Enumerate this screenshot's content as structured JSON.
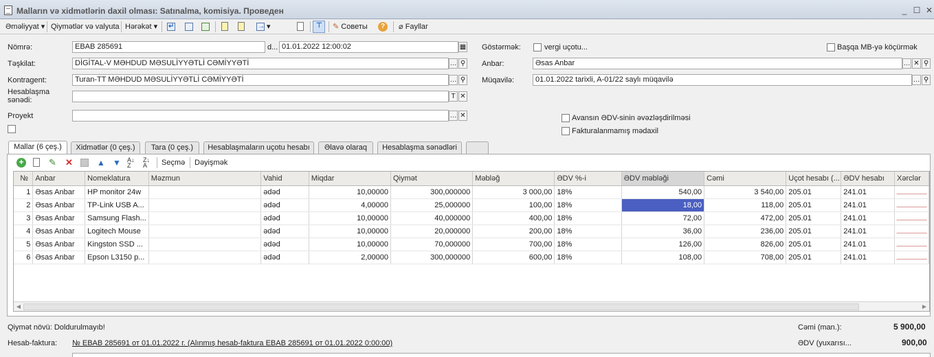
{
  "window": {
    "title": "Malların və xidmətlərin daxil olması: Satınalma, komisiya. Проведен"
  },
  "toolbar": {
    "emeliyyat": "Əməliyyat",
    "qiymetler": "Qiymətlər və valyuta",
    "hereket": "Hərəkət",
    "sovety": "Советы",
    "fayllar": "Fayllar"
  },
  "form": {
    "nomre_label": "Nömrə:",
    "nomre_value": "EBAB 285691",
    "date_prefix": "d...",
    "date_value": "01.01.2022 12:00:02",
    "teshkilat_label": "Təşkilat:",
    "teshkilat_value": "DİGİTAL-V  MƏHDUD MƏSULİYYƏTLİ CƏMİYYƏTİ",
    "kontragent_label": "Kontragent:",
    "kontragent_value": "Turan-TT MƏHDUD MƏSULİYYƏTLİ CƏMİYYƏTİ",
    "hesablashma_label_1": "Hesablaşma",
    "hesablashma_label_2": "sənədi:",
    "hesablashma_value": "",
    "proyekt_label": "Proyekt",
    "proyekt_value": "",
    "gostermek_label": "Göstərmək:",
    "vergi_label": "vergi uçotu...",
    "basqa_label": "Başqa MB-yə köçürmək",
    "anbar_label": "Anbar:",
    "anbar_value": "Əsas Anbar",
    "muqavile_label": "Müqavilə:",
    "muqavile_value": "01.01.2022 tarixli, A-01/22 saylı müqavilə",
    "avans_label": "Avansın ƏDV-sinin əvəzləşdirilməsi",
    "faktura_label": "Fakturalanmamış mədaxil"
  },
  "tabs": [
    "Mallar (6 çeş.)",
    "Xidmətlər (0 çeş.)",
    "Tara (0 çeş.)",
    "Hesablaşmaların uçotu hesabı",
    "Əlavə olaraq",
    "Hesablaşma sənədləri",
    ""
  ],
  "gridbar": {
    "secme": "Seçmə",
    "deyishmek": "Dəyişmək"
  },
  "table": {
    "columns": [
      "№",
      "Anbar",
      "Nomeklatura",
      "Məzmun",
      "Vahid",
      "Miqdar",
      "Qiymət",
      "Məbləğ",
      "ƏDV %-i",
      "ƏDV məbləği",
      "Cəmi",
      "Uçot hesabı (...",
      "ƏDV hesabı",
      "Xərclər"
    ],
    "rows": [
      [
        "1",
        "Əsas Anbar",
        "HP monitor 24w",
        "",
        "ədəd",
        "10,00000",
        "300,000000",
        "3 000,00",
        "18%",
        "540,00",
        "3 540,00",
        "205.01",
        "241.01",
        ""
      ],
      [
        "2",
        "Əsas Anbar",
        "TP-Link USB A...",
        "",
        "ədəd",
        "4,00000",
        "25,000000",
        "100,00",
        "18%",
        "18,00",
        "118,00",
        "205.01",
        "241.01",
        ""
      ],
      [
        "3",
        "Əsas Anbar",
        "Samsung Flash...",
        "",
        "ədəd",
        "10,00000",
        "40,000000",
        "400,00",
        "18%",
        "72,00",
        "472,00",
        "205.01",
        "241.01",
        ""
      ],
      [
        "4",
        "Əsas Anbar",
        "Logitech Mouse",
        "",
        "ədəd",
        "10,00000",
        "20,000000",
        "200,00",
        "18%",
        "36,00",
        "236,00",
        "205.01",
        "241.01",
        ""
      ],
      [
        "5",
        "Əsas Anbar",
        "Kingston SSD ...",
        "",
        "ədəd",
        "10,00000",
        "70,000000",
        "700,00",
        "18%",
        "126,00",
        "826,00",
        "205.01",
        "241.01",
        ""
      ],
      [
        "6",
        "Əsas Anbar",
        "Epson L3150 p...",
        "",
        "ədəd",
        "2,00000",
        "300,000000",
        "600,00",
        "18%",
        "108,00",
        "708,00",
        "205.01",
        "241.01",
        ""
      ]
    ]
  },
  "footer": {
    "qiymet_novu": "Qiymət növü: Doldurulmayıb!",
    "cemi_label": "Cəmi (man.):",
    "cemi_value": "5 900,00",
    "hesab_faktura_label": "Hesab-faktura:",
    "hesab_faktura_link": "№ EBAB 285691 от 01.01.2022 г. (Alınmış hesab-faktura EBAB 285691 от 01.01.2022 0:00:00)",
    "edv_label": "ƏDV (yuxarısı...",
    "edv_value": "900,00"
  }
}
